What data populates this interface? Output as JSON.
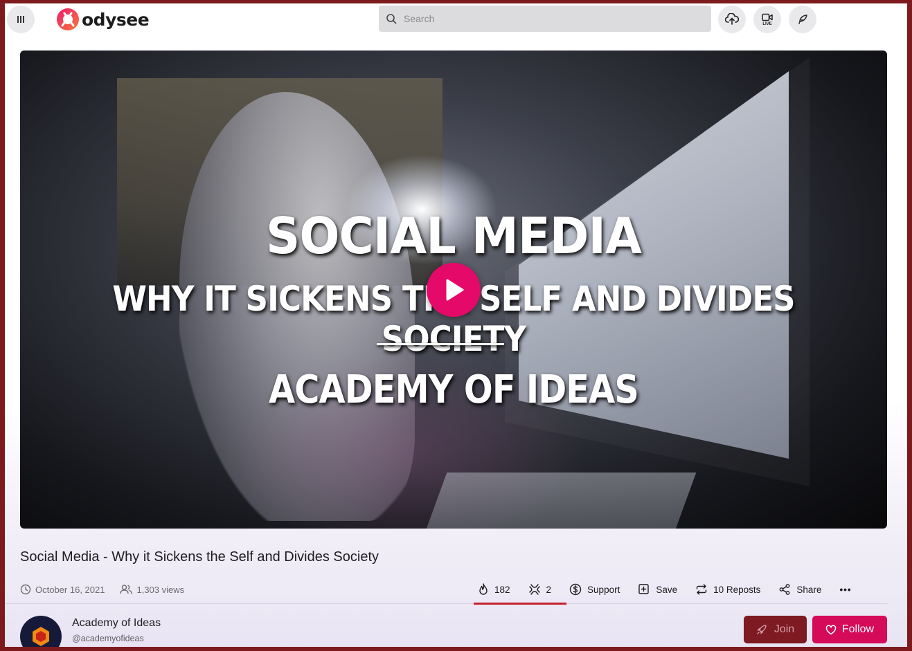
{
  "header": {
    "logo_text": "odysee",
    "search_placeholder": "Search",
    "live_label": "LIVE"
  },
  "video": {
    "overlay_title": "SOCIAL MEDIA",
    "overlay_subtitle": "WHY IT SICKENS THE SELF AND DIVIDES SOCIETY",
    "overlay_channel": "ACADEMY OF IDEAS",
    "title": "Social Media - Why it Sickens the Self and Divides Society"
  },
  "meta": {
    "date": "October 16, 2021",
    "views": "1,303 views"
  },
  "actions": {
    "fire_count": "182",
    "slime_count": "2",
    "support": "Support",
    "save": "Save",
    "reposts": "10 Reposts",
    "share": "Share",
    "more": "•••"
  },
  "channel": {
    "name": "Academy of Ideas",
    "handle": "@academyofideas",
    "join": "Join",
    "follow": "Follow"
  },
  "colors": {
    "accent": "#e5096a",
    "follow": "#d50a58",
    "join": "#7d1a22"
  }
}
